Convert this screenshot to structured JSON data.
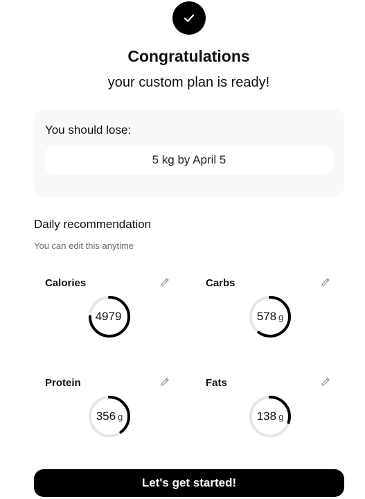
{
  "header": {
    "title": "Congratulations",
    "subtitle": "your custom plan is ready!"
  },
  "goal": {
    "label": "You should lose:",
    "value": "5 kg by April 5"
  },
  "daily": {
    "title": "Daily recommendation",
    "subtitle": "You can edit this anytime"
  },
  "metrics": [
    {
      "label": "Calories",
      "value": "4979",
      "unit": "",
      "progress": 0.75
    },
    {
      "label": "Carbs",
      "value": "578",
      "unit": "g",
      "progress": 0.6
    },
    {
      "label": "Protein",
      "value": "356",
      "unit": "g",
      "progress": 0.4
    },
    {
      "label": "Fats",
      "value": "138",
      "unit": "g",
      "progress": 0.3
    }
  ],
  "cta": {
    "label": "Let's get started!"
  },
  "colors": {
    "accent": "#000000",
    "card_bg": "#f7f8fa",
    "ring_track": "#e6e6ea"
  },
  "icons": {
    "badge": "checkmark-icon",
    "edit": "pencil-icon"
  }
}
